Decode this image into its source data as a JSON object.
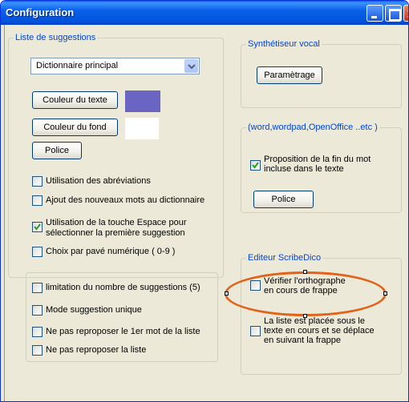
{
  "window": {
    "title": "Configuration",
    "colors": {
      "titlebar": "#0a5fe8",
      "body": "#ece9d8",
      "legend": "#0046d5",
      "highlight_ellipse": "#e0631a"
    }
  },
  "suggestions": {
    "legend": "Liste de suggestions",
    "dictionary_select": {
      "value": "Dictionnaire principal"
    },
    "text_color_button": "Couleur du texte",
    "text_color_swatch": "#6a65c3",
    "background_color_button": "Couleur du fond",
    "background_color_swatch": "#ffffff",
    "font_button": "Police",
    "options": [
      {
        "label": "Utilisation des abréviations",
        "checked": false
      },
      {
        "label": "Ajout des nouveaux mots au dictionnaire",
        "checked": false
      },
      {
        "label_line1": "Utilisation de  la  touche Espace pour",
        "label_line2": "sélectionner la première suggestion",
        "checked": true
      },
      {
        "label": "Choix par pavé numérique ( 0-9 )",
        "checked": false
      }
    ]
  },
  "limits": {
    "options": [
      {
        "label": "limitation du  nombre de suggestions (5)",
        "checked": false
      },
      {
        "label": "Mode suggestion unique",
        "checked": false
      },
      {
        "label": "Ne pas reproposer le 1er mot de la liste",
        "checked": false
      },
      {
        "label": "Ne pas reproposer la liste",
        "checked": false
      }
    ]
  },
  "synth": {
    "legend": "Synthétiseur vocal",
    "settings_button": "Paramètrage"
  },
  "external": {
    "legend": "(word,wordpad,OpenOffice ..etc )",
    "option": {
      "label_line1": "Proposition de la fin  du mot",
      "label_line2": "incluse dans le texte",
      "checked": true
    },
    "font_button": "Police"
  },
  "editor": {
    "legend": "Editeur ScribeDico",
    "spellcheck": {
      "label_line1": "Vérifier l'orthographe",
      "label_line2": "en cours de frappe",
      "checked": false
    },
    "list_follow": {
      "label_line1": "La liste est placée sous le",
      "label_line2": "texte en cours et se déplace",
      "label_line3": "en suivant la frappe",
      "checked": false
    }
  }
}
